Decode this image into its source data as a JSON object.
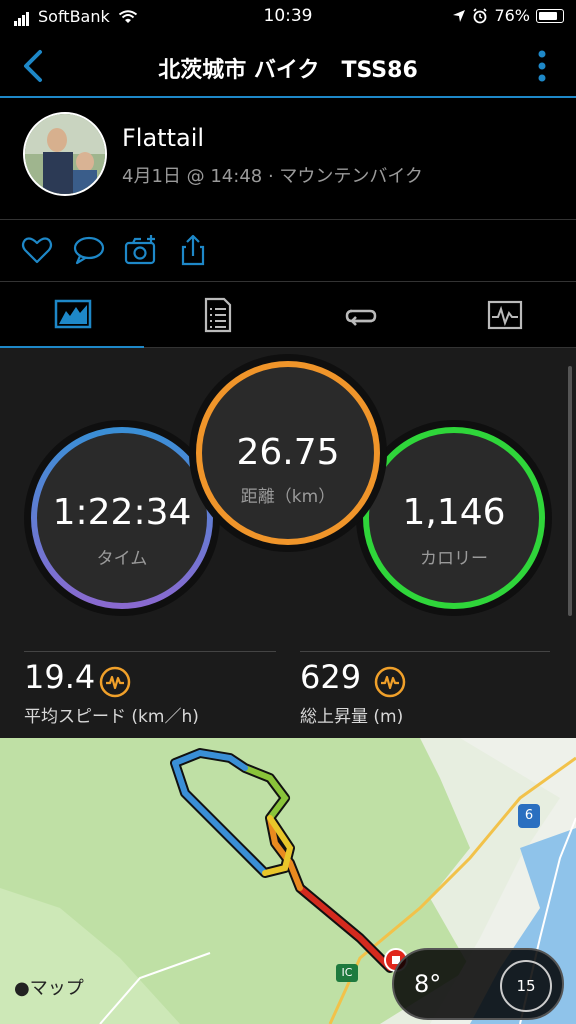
{
  "status_bar": {
    "carrier": "SoftBank",
    "time": "10:39",
    "battery": "76%"
  },
  "nav": {
    "title": "北茨城市 バイク　TSS86"
  },
  "activity": {
    "user_name": "Flattail",
    "meta": "4月1日 @ 14:48 · マウンテンバイク"
  },
  "rings": {
    "time": {
      "value": "1:22:34",
      "label": "タイム",
      "colors": [
        "#3a8fd6",
        "#8a6ad0"
      ]
    },
    "distance": {
      "value": "26.75",
      "label": "距離（km）",
      "color": "#f0952a"
    },
    "calories": {
      "value": "1,146",
      "label": "カロリー",
      "color": "#2fd63a"
    }
  },
  "metrics": {
    "avg_speed": {
      "value": "19.4",
      "label": "平均スピード (km／h)"
    },
    "elevation_gain": {
      "value": "629",
      "label": "総上昇量 (m)"
    }
  },
  "map": {
    "attribution": "マップ",
    "weather_temp": "8°",
    "wind_speed": "15",
    "road_badge": "6",
    "ic_badge": "IC"
  },
  "colors": {
    "accent": "#1e88c8",
    "metric_icon": "#f0a02a"
  }
}
